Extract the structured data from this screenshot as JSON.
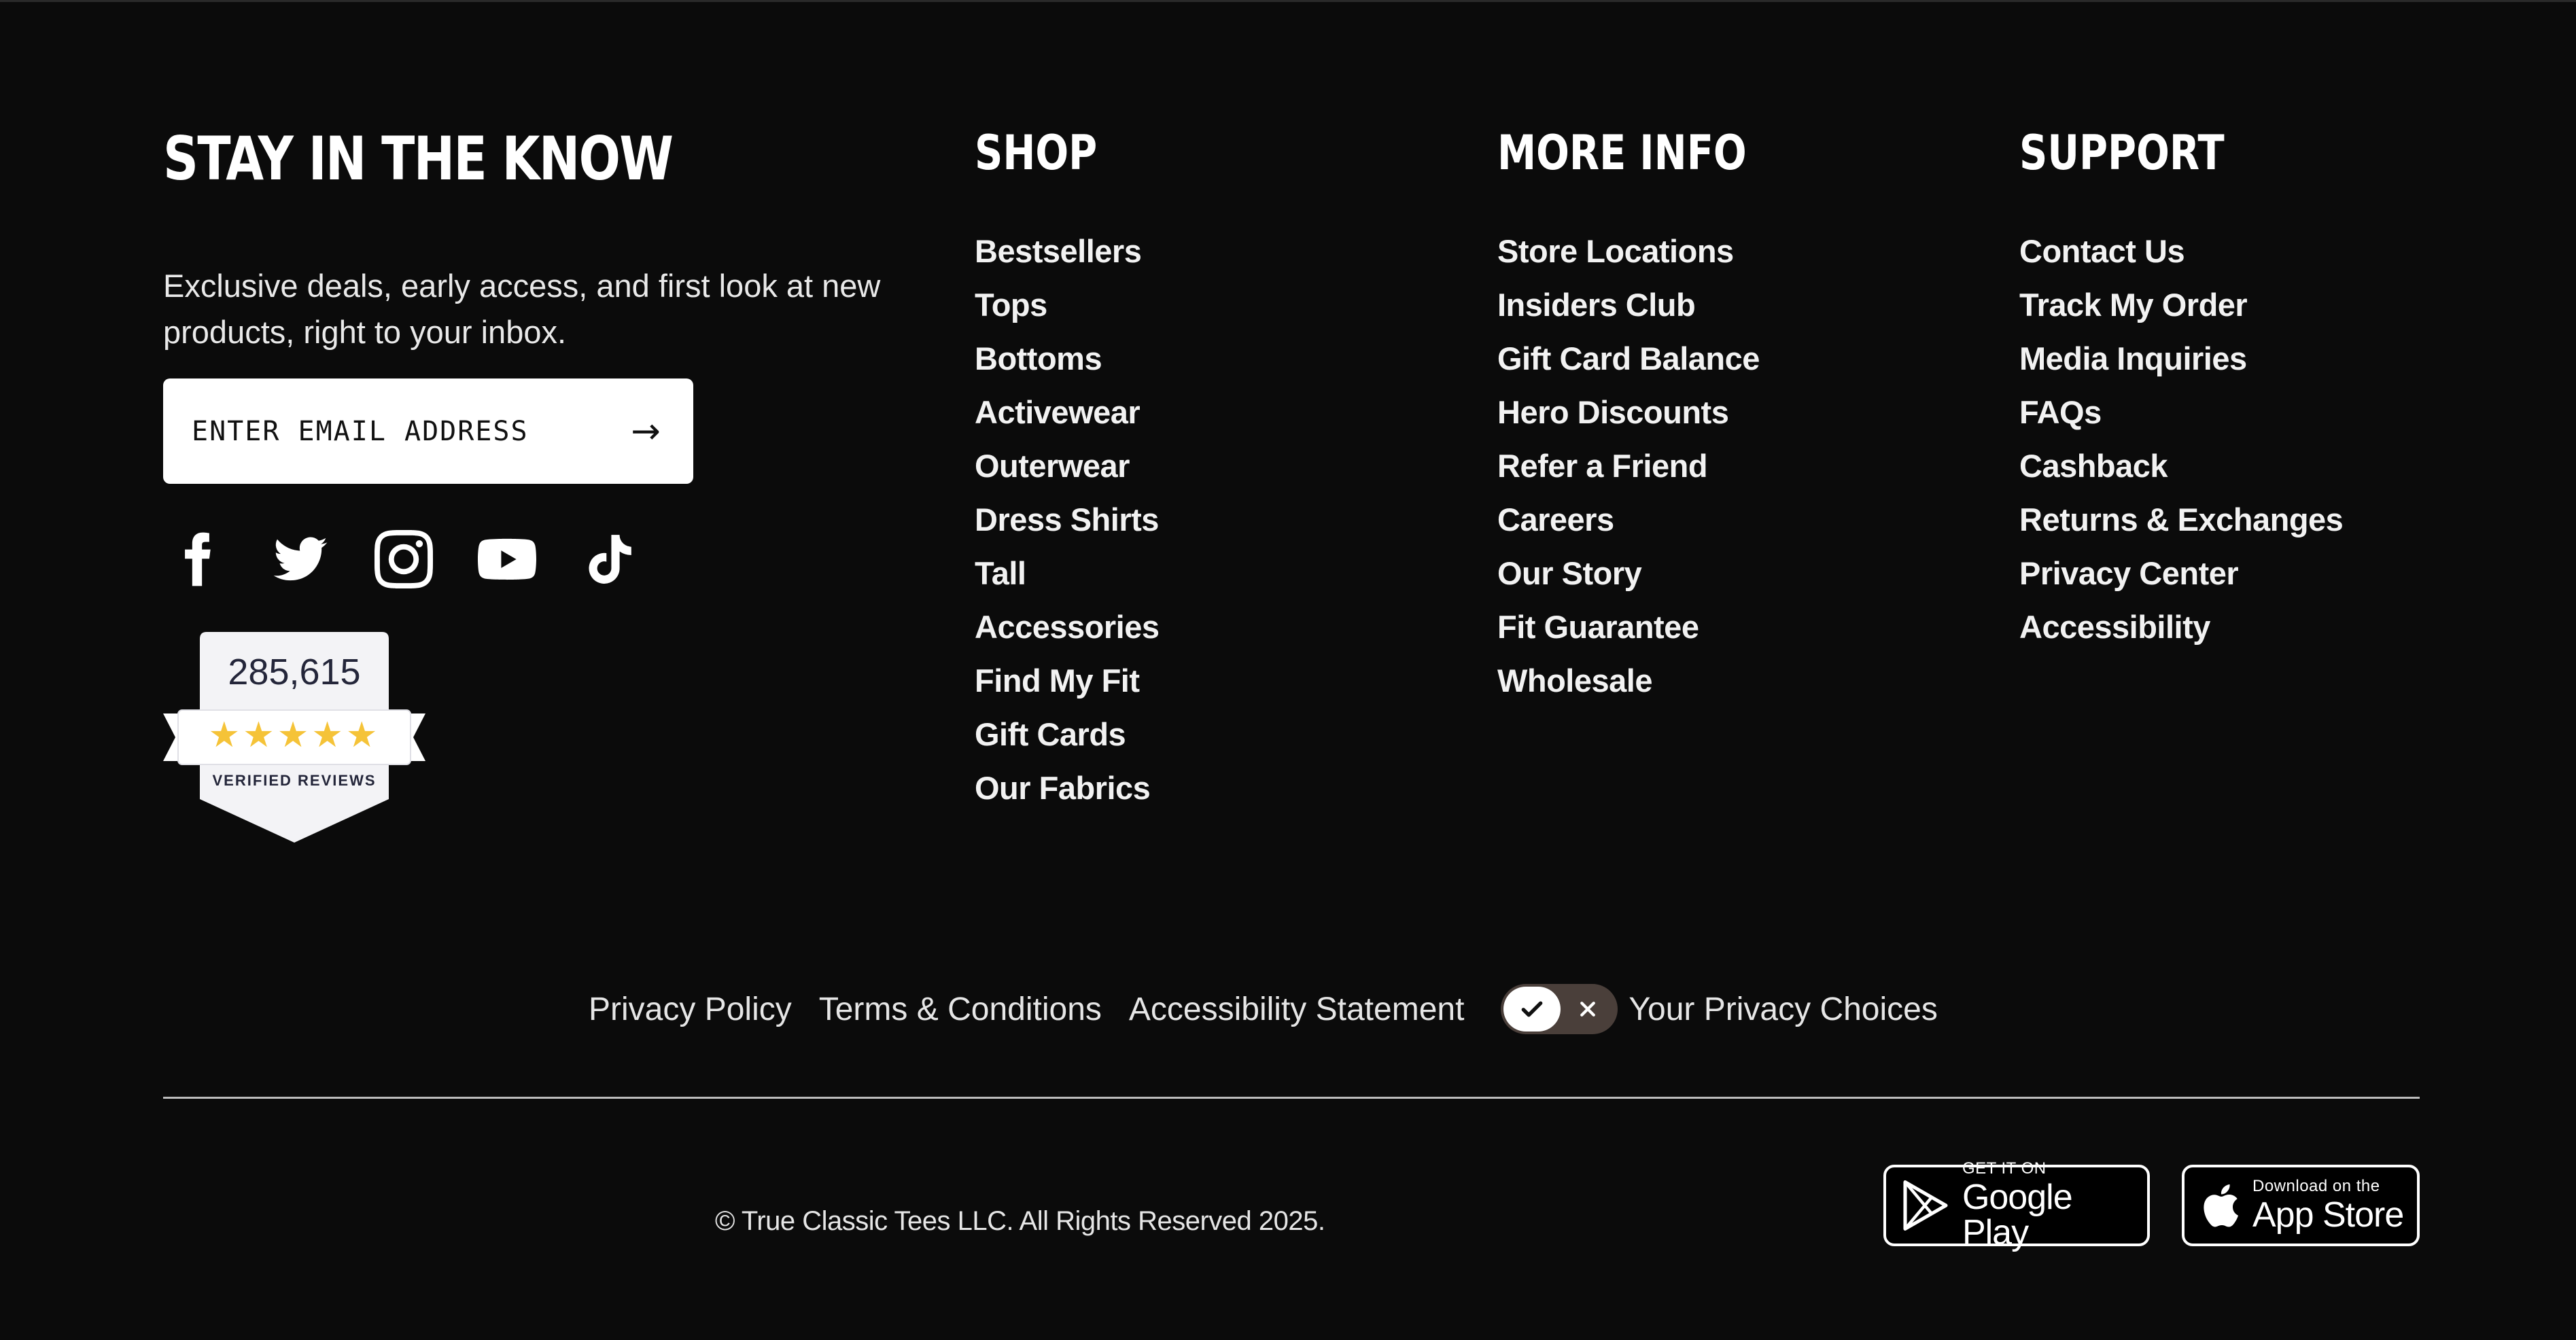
{
  "newsletter": {
    "title": "STAY IN THE KNOW",
    "description": "Exclusive deals, early access, and first look at new products, right to your inbox.",
    "email_placeholder": "ENTER EMAIL ADDRESS",
    "submit_glyph": "→"
  },
  "socials": [
    "facebook-icon",
    "twitter-icon",
    "instagram-icon",
    "youtube-icon",
    "tiktok-icon"
  ],
  "reviews_badge": {
    "count": "285,615",
    "stars": "★★★★★",
    "label": "VERIFIED REVIEWS",
    "rating_fraction": 0.9
  },
  "columns": {
    "shop": {
      "heading": "SHOP",
      "links": [
        "Bestsellers",
        "Tops",
        "Bottoms",
        "Activewear",
        "Outerwear",
        "Dress Shirts",
        "Tall",
        "Accessories",
        "Find My Fit",
        "Gift Cards",
        "Our Fabrics"
      ]
    },
    "more_info": {
      "heading": "MORE INFO",
      "links": [
        "Store Locations",
        "Insiders Club",
        "Gift Card Balance",
        "Hero Discounts",
        "Refer a Friend",
        "Careers",
        "Our Story",
        "Fit Guarantee",
        "Wholesale"
      ]
    },
    "support": {
      "heading": "SUPPORT",
      "links": [
        "Contact Us",
        "Track My Order",
        "Media Inquiries",
        "FAQs",
        "Cashback",
        "Returns & Exchanges",
        "Privacy Center",
        "Accessibility"
      ]
    }
  },
  "legal": {
    "privacy_policy": "Privacy Policy",
    "terms": "Terms & Conditions",
    "accessibility_statement": "Accessibility Statement",
    "privacy_choices": "Your Privacy Choices"
  },
  "copyright": "© True Classic Tees LLC. All Rights Reserved 2025.",
  "app_stores": {
    "google": {
      "small": "GET IT ON",
      "big": "Google Play"
    },
    "apple": {
      "small": "Download on the",
      "big": "App Store"
    }
  },
  "colors": {
    "background": "#0b0b0b",
    "text": "#ffffff",
    "star": "#f5c338",
    "toggle_bg": "#4a3f3a"
  }
}
